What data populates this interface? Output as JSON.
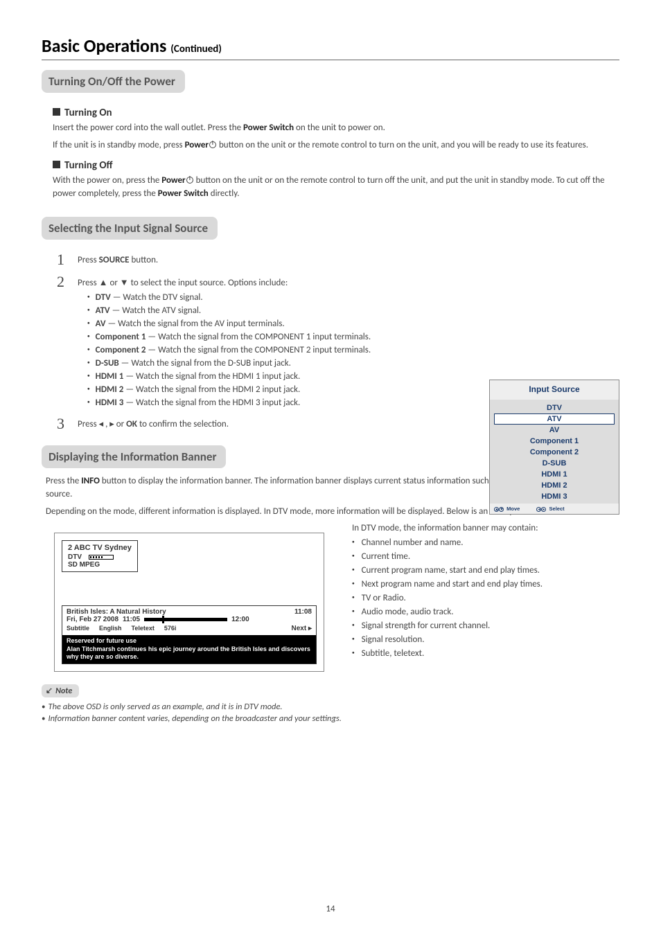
{
  "page": {
    "title": "Basic Operations",
    "title_suffix": "(Continued)",
    "number": "14"
  },
  "s1": {
    "heading": "Turning On/Off the Power",
    "on_head": "Turning On",
    "on_p1_a": "Insert the power cord into the wall outlet. Press the ",
    "on_p1_b": "Power Switch",
    "on_p1_c": " on the unit to power on.",
    "on_p2_a": "If the unit is in standby mode, press ",
    "on_p2_b": "Power",
    "on_p2_c": " button on the unit or the remote control to turn on the unit, and you will be ready to use its features.",
    "off_head": "Turning Off",
    "off_p_a": "With the power on, press the ",
    "off_p_b": "Power",
    "off_p_c": " button on the unit or on the remote control to turn off the unit, and put the unit in standby mode. To cut off the power completely, press the ",
    "off_p_d": "Power Switch",
    "off_p_e": " directly."
  },
  "s2": {
    "heading": "Selecting the Input Signal Source",
    "step1_a": "Press ",
    "step1_b": "SOURCE",
    "step1_c": " button.",
    "step2": "Press  ▲ or ▼ to select the input source. Options include:",
    "options": [
      {
        "k": "DTV",
        "v": " — Watch the DTV signal."
      },
      {
        "k": "ATV",
        "v": " — Watch the ATV signal."
      },
      {
        "k": "AV",
        "v": " — Watch the signal from the AV input terminals."
      },
      {
        "k": "Component 1",
        "v": " — Watch the signal from the COMPONENT 1 input terminals."
      },
      {
        "k": "Component 2",
        "v": " — Watch the signal from the COMPONENT 2 input terminals."
      },
      {
        "k": "D-SUB",
        "v": " — Watch the signal from the D-SUB input jack."
      },
      {
        "k": "HDMI 1",
        "v": " — Watch the signal from the HDMI 1 input jack."
      },
      {
        "k": "HDMI 2",
        "v": " — Watch the signal from the HDMI 2 input jack."
      },
      {
        "k": "HDMI 3",
        "v": " — Watch the signal from the HDMI 3 input jack."
      }
    ],
    "step3_a": "Press   ◂ , ▸  or ",
    "step3_b": "OK",
    "step3_c": " to confirm the selection."
  },
  "osd": {
    "title": "Input Source",
    "items": [
      "DTV",
      "ATV",
      "AV",
      "Component 1",
      "Component 2",
      "D-SUB",
      "HDMI 1",
      "HDMI 2",
      "HDMI 3"
    ],
    "selected_index": 1,
    "foot_move": "Move",
    "foot_select": "Select"
  },
  "s3": {
    "heading": "Displaying the Information Banner",
    "p1_a": "Press the ",
    "p1_b": "INFO",
    "p1_c": " button to display the information banner. The information banner displays current status information such as the channel number and signal source.",
    "p2": "Depending on the mode, different information is displayed. In DTV mode, more information will be displayed. Below is an example banner in DTV mode.",
    "right_intro": "In DTV mode, the information banner may contain:",
    "right_items": [
      "Channel number and name.",
      "Current time.",
      "Current program name, start and end play times.",
      "Next program name and start and end play times.",
      "TV or Radio.",
      "Audio mode, audio track.",
      "Signal strength for current channel.",
      "Signal resolution.",
      "Subtitle, teletext."
    ]
  },
  "banner": {
    "ch": "2   ABC TV Sydney",
    "mode": "DTV",
    "sd": "SD  MPEG",
    "prog": "British Isles: A Natural History",
    "end": "11:08",
    "date": "Fri, Feb 27 2008",
    "start": "11:05",
    "mid": "12:00",
    "sub": "Subtitle",
    "lang": "English",
    "ttx": "Teletext",
    "res": "576i",
    "next": "Next ▸",
    "desc1": "Reserved for future use",
    "desc2": "Alan Titchmarsh continues his epic journey around the British Isles and discovers why they are so diverse."
  },
  "notes": {
    "label": "Note",
    "n1": "The above OSD is only served as an example, and it is in DTV mode.",
    "n2": "Information banner content varies, depending on the broadcaster and your settings."
  }
}
